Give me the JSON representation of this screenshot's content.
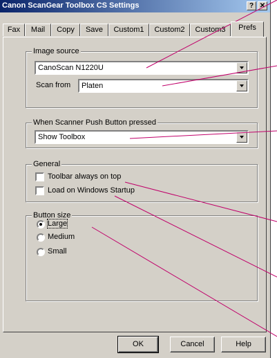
{
  "window": {
    "title": "Canon ScanGear Toolbox CS Settings",
    "help_glyph": "?",
    "close_glyph": "✕"
  },
  "tabs": [
    {
      "label": "Fax"
    },
    {
      "label": "Mail"
    },
    {
      "label": "Copy"
    },
    {
      "label": "Save"
    },
    {
      "label": "Custom1"
    },
    {
      "label": "Custom2"
    },
    {
      "label": "Custom3"
    },
    {
      "label": "Prefs",
      "active": true
    }
  ],
  "image_source": {
    "legend": "Image source",
    "scanner": "CanoScan N1220U",
    "scan_from_label": "Scan from",
    "scan_from_value": "Platen"
  },
  "push_button": {
    "legend": "When Scanner Push Button pressed",
    "value": "Show Toolbox"
  },
  "general": {
    "legend": "General",
    "toolbar_on_top": "Toolbar always on top",
    "load_on_startup": "Load on Windows Startup"
  },
  "button_size": {
    "legend": "Button size",
    "options": [
      "Large",
      "Medium",
      "Small"
    ],
    "selected": "Large"
  },
  "footer": {
    "ok": "OK",
    "cancel": "Cancel",
    "help": "Help"
  },
  "colors": {
    "title_start": "#0a246a",
    "title_end": "#a6caf0",
    "callout_line": "#c0006a"
  }
}
